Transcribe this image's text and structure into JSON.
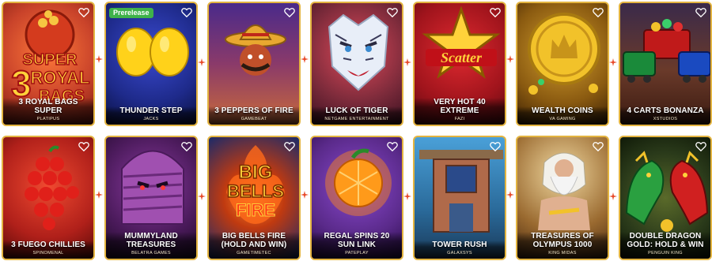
{
  "games": [
    {
      "title": "3 Royal Bags Super",
      "provider": "Platipus",
      "bg": "#c9432a",
      "badge": null
    },
    {
      "title": "Thunder Step",
      "provider": "Jacks",
      "bg": "#1e2a8a",
      "badge": "Prerelease"
    },
    {
      "title": "3 Peppers of Fire",
      "provider": "Gamebeat",
      "bg": "#6a2c6c",
      "badge": null
    },
    {
      "title": "Luck of Tiger",
      "provider": "Netgame Entertainment",
      "bg": "#7a2a3a",
      "badge": null
    },
    {
      "title": "Very Hot 40 Extreme",
      "provider": "Fazi",
      "bg": "#a0141c",
      "badge": null
    },
    {
      "title": "Wealth Coins",
      "provider": "VA Gaming",
      "bg": "#8a5a10",
      "badge": null
    },
    {
      "title": "4 Carts Bonanza",
      "provider": "Xstudios",
      "bg": "#5a2a1c",
      "badge": null
    },
    {
      "title": "3 Fuego Chillies",
      "provider": "Spinomenal",
      "bg": "#b0201a",
      "badge": null
    },
    {
      "title": "Mummyland Treasures",
      "provider": "Belatra Games",
      "bg": "#4a1a5a",
      "badge": null
    },
    {
      "title": "Big Bells Fire (Hold and Win)",
      "provider": "Gametimetec",
      "bg": "#1a2a6a",
      "badge": null
    },
    {
      "title": "Regal Spins 20 Sun Link",
      "provider": "Pateplay",
      "bg": "#5a2a8a",
      "badge": null
    },
    {
      "title": "Tower Rush",
      "provider": "Galaxsys",
      "bg": "#2a6a9a",
      "badge": null
    },
    {
      "title": "Treasures of Olympus 1000",
      "provider": "King Midas",
      "bg": "#9a6a30",
      "badge": null
    },
    {
      "title": "Double Dragon Gold: Hold & Win",
      "provider": "Penguin King",
      "bg": "#2a3a1a",
      "badge": null
    }
  ]
}
